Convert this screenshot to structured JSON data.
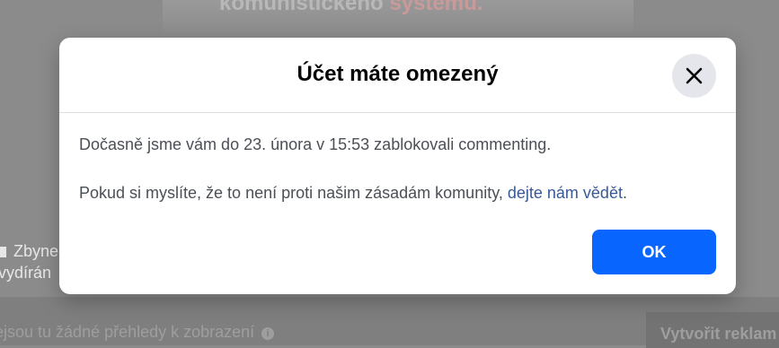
{
  "background": {
    "image_caption_part1": "komunistického ",
    "image_caption_part2": "systému.",
    "side_line1": "Zbyne",
    "side_line2": "vydírán",
    "insights_text": "ejsou tu žádné přehledy k zobrazení",
    "create_ad_label": "Vytvořit reklam"
  },
  "dialog": {
    "title": "Účet máte omezený",
    "message": "Dočasně jsme vám do 23. února v 15:53 zablokovali commenting.",
    "feedback_prefix": "Pokud si myslíte, že to není proti našim zásadám komunity, ",
    "feedback_link": "dejte nám vědět",
    "feedback_suffix": ".",
    "ok_label": "OK",
    "close_icon": "close-icon"
  },
  "colors": {
    "primary_button": "#0866ff",
    "link": "#385898",
    "close_button_bg": "#e4e6eb"
  }
}
